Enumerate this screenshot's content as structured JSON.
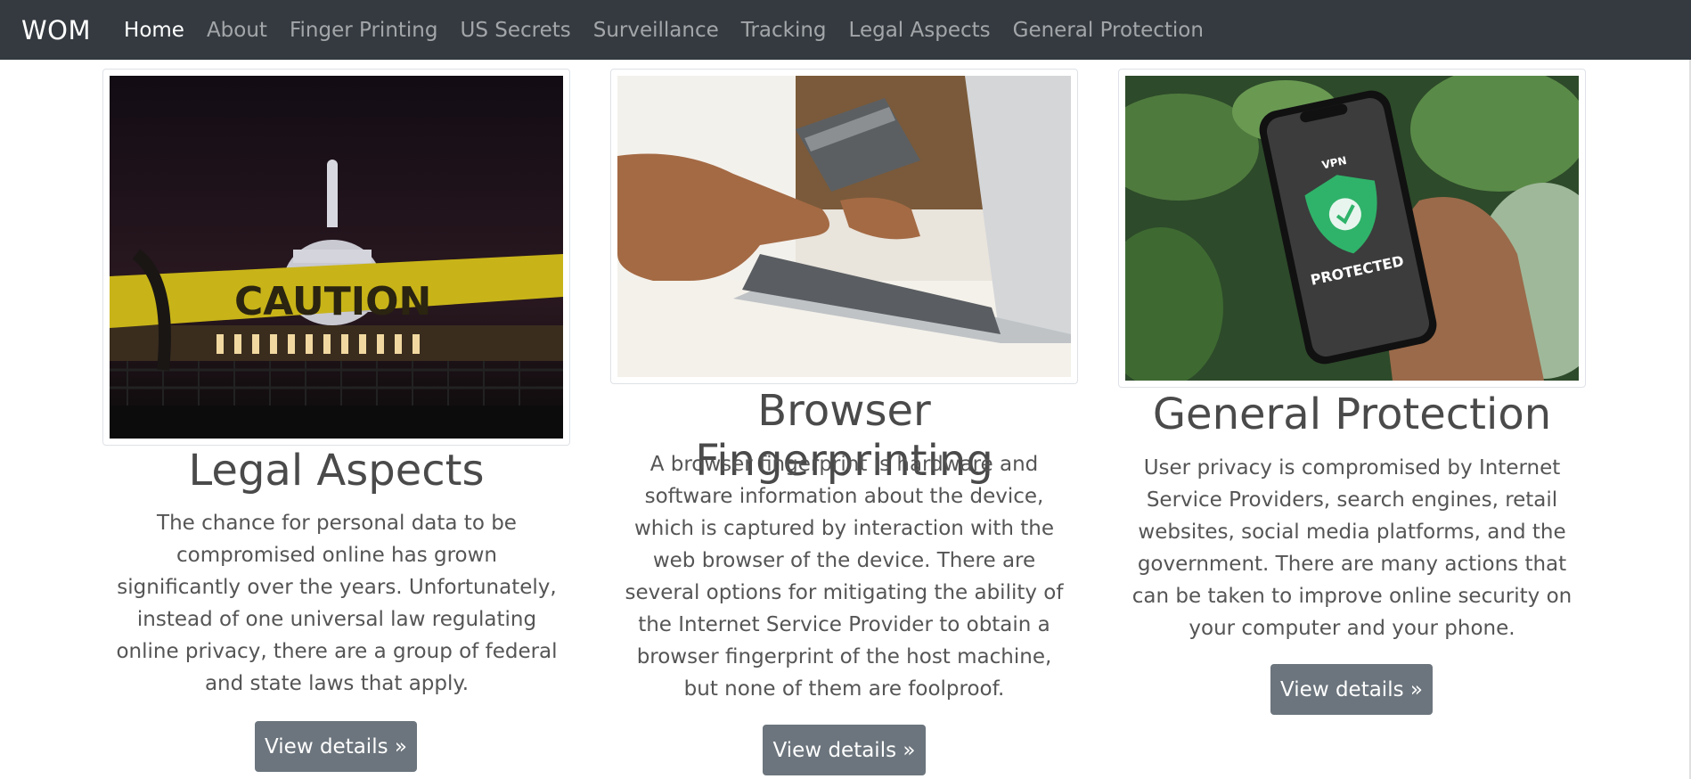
{
  "navbar": {
    "brand": "WOM",
    "items": [
      "Home",
      "About",
      "Finger Printing",
      "US Secrets",
      "Surveillance",
      "Tracking",
      "Legal Aspects",
      "General Protection"
    ]
  },
  "cards": [
    {
      "title": "Legal Aspects",
      "image_caption_text": "CAUTION",
      "text": "The chance for personal data to be compromised online has grown significantly over the years. Unfortunately, instead of one universal law regulating online privacy, there are a group of federal and state laws that apply.",
      "button": "View details »"
    },
    {
      "title": "Browser Fingerprinting",
      "text": "A browser fingerprint is hardware and software information about the device, which is captured by interaction with the web browser of the device. There are several options for mitigating the ability of the Internet Service Provider to obtain a browser fingerprint of the host machine, but none of them are foolproof.",
      "button": "View details »"
    },
    {
      "title": "General Protection",
      "image_text_top": "VPN",
      "image_text_bottom": "PROTECTED",
      "text": "User privacy is compromised by Internet Service Providers, search engines, retail websites, social media platforms, and the government. There are many actions that can be taken to improve online security on your computer and your phone.",
      "button": "View details »"
    }
  ],
  "colors": {
    "navbar_bg": "#343a40",
    "button_bg": "#6c757d"
  }
}
